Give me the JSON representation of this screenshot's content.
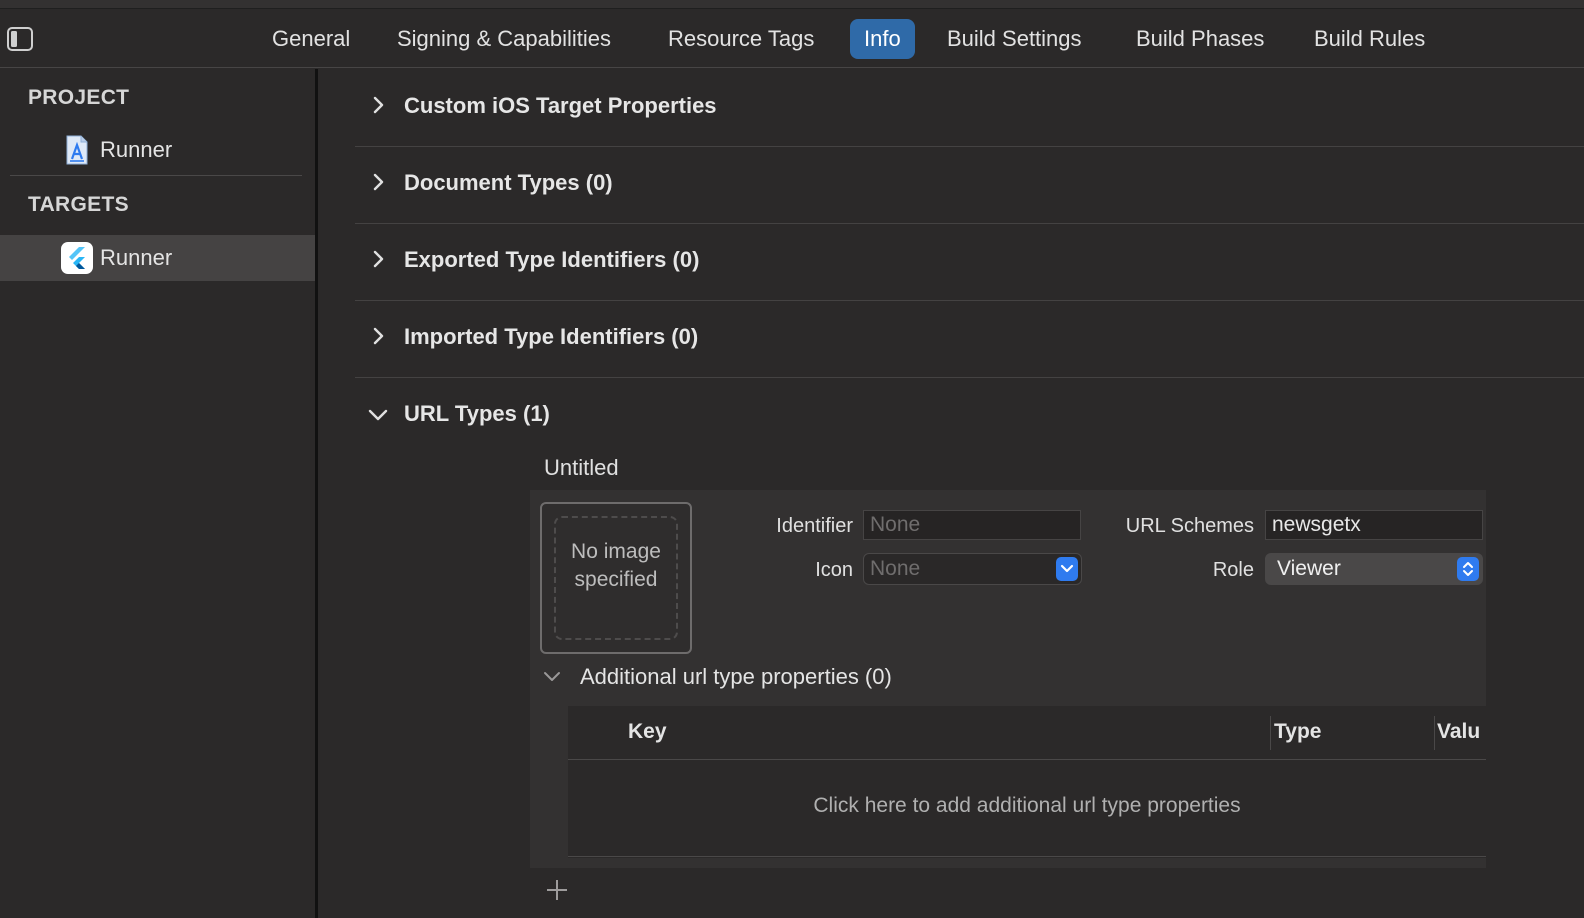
{
  "tabs": [
    {
      "label": "General",
      "active": false
    },
    {
      "label": "Signing & Capabilities",
      "active": false
    },
    {
      "label": "Resource Tags",
      "active": false
    },
    {
      "label": "Info",
      "active": true
    },
    {
      "label": "Build Settings",
      "active": false
    },
    {
      "label": "Build Phases",
      "active": false
    },
    {
      "label": "Build Rules",
      "active": false
    }
  ],
  "sidebar": {
    "project_header": "PROJECT",
    "project_item": "Runner",
    "targets_header": "TARGETS",
    "target_item": "Runner"
  },
  "sections": [
    {
      "title": "Custom iOS Target Properties"
    },
    {
      "title": "Document Types (0)"
    },
    {
      "title": "Exported Type Identifiers (0)"
    },
    {
      "title": "Imported Type Identifiers (0)"
    }
  ],
  "url_types": {
    "title": "URL Types (1)",
    "entry_name": "Untitled",
    "image_placeholder": "No image specified",
    "identifier_label": "Identifier",
    "identifier_placeholder": "None",
    "icon_label": "Icon",
    "icon_value": "None",
    "url_schemes_label": "URL Schemes",
    "url_schemes_value": "newsgetx",
    "role_label": "Role",
    "role_value": "Viewer",
    "additional_title": "Additional url type properties (0)",
    "columns": [
      "Key",
      "Type",
      "Valu"
    ],
    "empty_message": "Click here to add additional url type properties"
  },
  "colors": {
    "accent": "#2f6aa8",
    "popup_button": "#2f7bef"
  }
}
